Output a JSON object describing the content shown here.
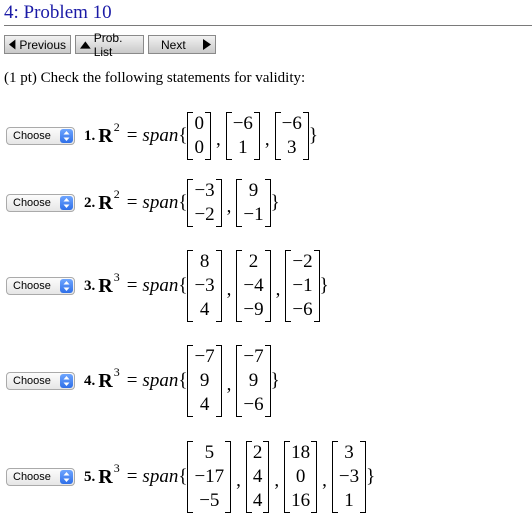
{
  "title": "4: Problem 10",
  "nav": {
    "previous": "Previous",
    "list": "Prob. List",
    "next": "Next"
  },
  "intro": "(1 pt) Check the following statements for validity:",
  "select_label": "Choose",
  "span_word": "span",
  "problems": [
    {
      "num": "1.",
      "R": "R",
      "dim": "2",
      "vectors": [
        [
          "0",
          "0"
        ],
        [
          "−6",
          "1"
        ],
        [
          "−6",
          "3"
        ]
      ]
    },
    {
      "num": "2.",
      "R": "R",
      "dim": "2",
      "vectors": [
        [
          "−3",
          "−2"
        ],
        [
          "9",
          "−1"
        ]
      ]
    },
    {
      "num": "3.",
      "R": "R",
      "dim": "3",
      "vectors": [
        [
          "8",
          "−3",
          "4"
        ],
        [
          "2",
          "−4",
          "−9"
        ],
        [
          "−2",
          "−1",
          "−6"
        ]
      ]
    },
    {
      "num": "4.",
      "R": "R",
      "dim": "3",
      "vectors": [
        [
          "−7",
          "9",
          "4"
        ],
        [
          "−7",
          "9",
          "−6"
        ]
      ]
    },
    {
      "num": "5.",
      "R": "R",
      "dim": "3",
      "vectors": [
        [
          "5",
          "−17",
          "−5"
        ],
        [
          "2",
          "4",
          "4"
        ],
        [
          "18",
          "0",
          "16"
        ],
        [
          "3",
          "−3",
          "1"
        ]
      ]
    }
  ]
}
